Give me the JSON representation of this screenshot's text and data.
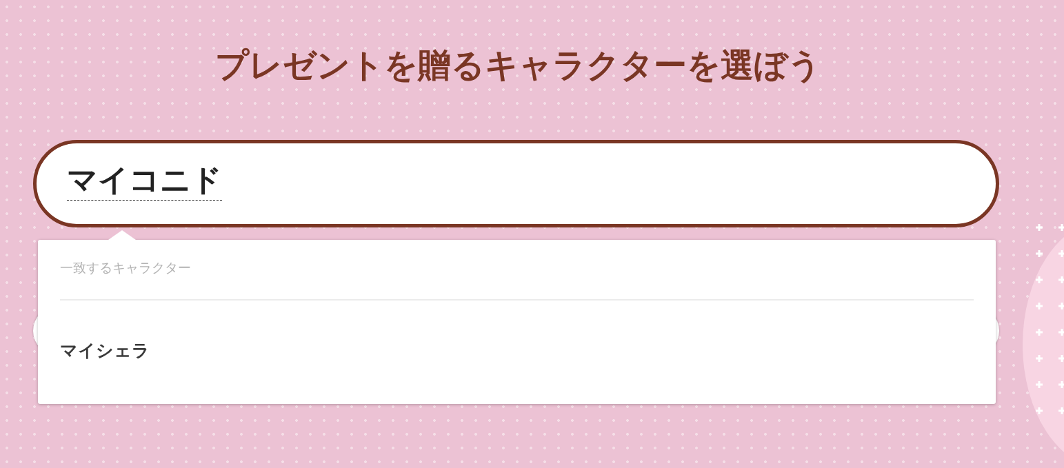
{
  "title": "プレゼントを贈るキャラクターを選ぼう",
  "search": {
    "value": "マイコニド",
    "composing": true
  },
  "suggestions": {
    "heading": "一致するキャラクター",
    "items": [
      {
        "label": "マイシェラ"
      }
    ]
  }
}
